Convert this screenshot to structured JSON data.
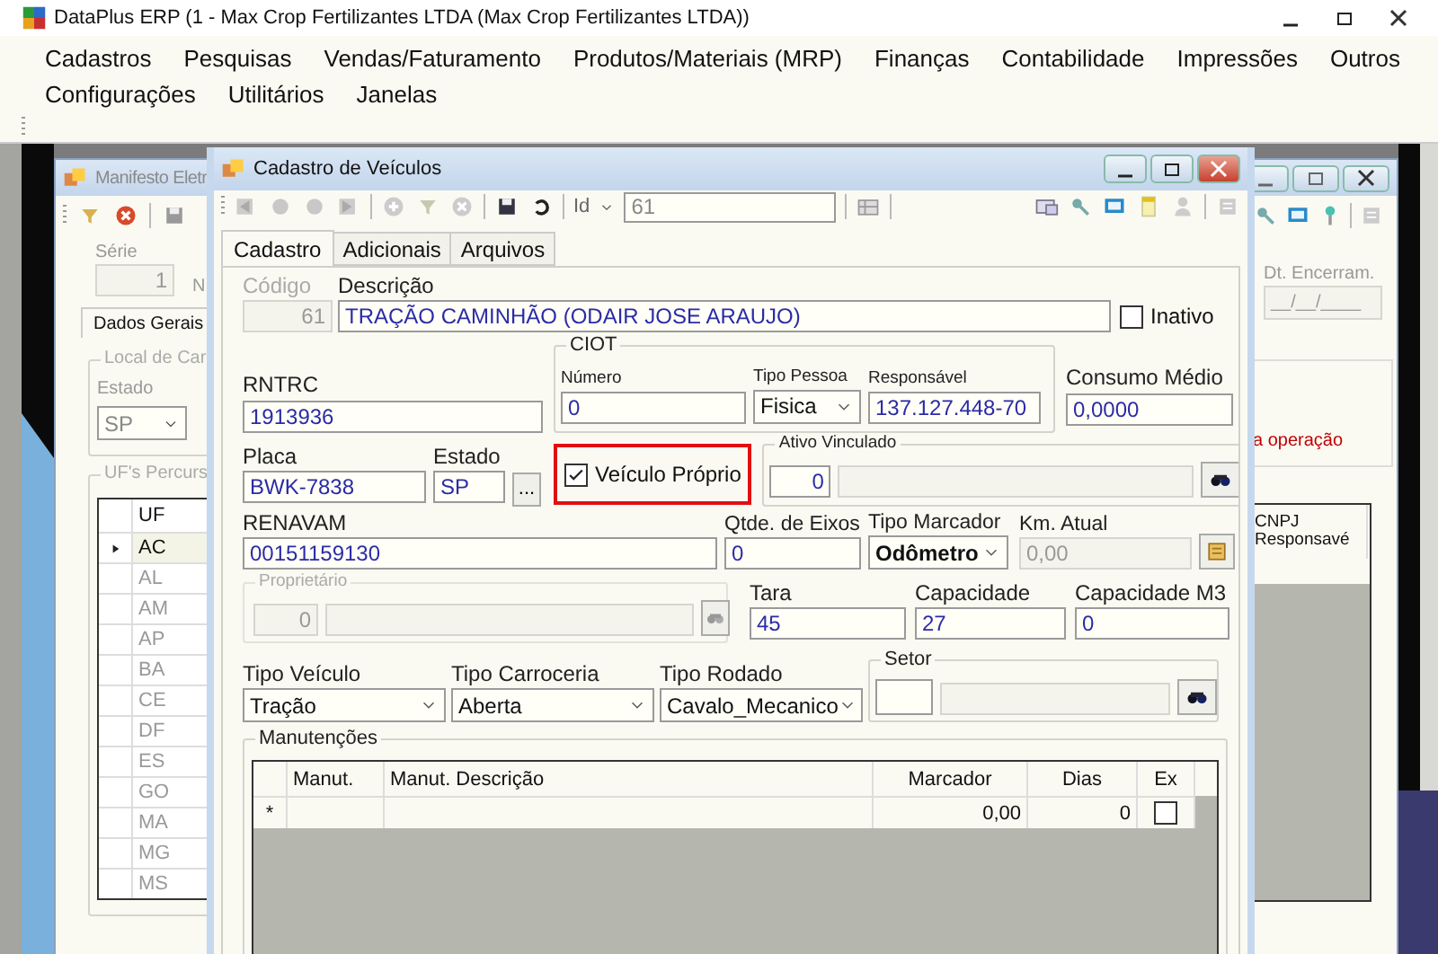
{
  "app": {
    "title": "DataPlus ERP (1 - Max Crop Fertilizantes LTDA  (Max Crop Fertilizantes LTDA))",
    "menu_rows": [
      {
        "items": [
          "Cadastros",
          "Pesquisas",
          "Vendas/Faturamento",
          "Produtos/Materiais (MRP)",
          "Finanças",
          "Contabilidade",
          "Impressões",
          "Outros"
        ]
      },
      {
        "items": [
          "Configurações",
          "Utilitários",
          "Janelas"
        ]
      }
    ]
  },
  "background_window": {
    "title": "Manifesto Eletr",
    "serie_label": "Série",
    "serie_value": "1",
    "numero_label": "N",
    "tabs": [
      {
        "label": "Dados Gerais",
        "selected": true
      }
    ],
    "local_group": "Local de Car",
    "estado_label": "Estado",
    "estado_value": "SP",
    "uf_group": "UF's Percurs",
    "uf_column": "UF",
    "uf_rows": [
      {
        "uf": "AC",
        "selected": true
      },
      {
        "uf": "AL",
        "selected": false
      },
      {
        "uf": "AM",
        "selected": false
      },
      {
        "uf": "AP",
        "selected": false
      },
      {
        "uf": "BA",
        "selected": false
      },
      {
        "uf": "CE",
        "selected": false
      },
      {
        "uf": "DF",
        "selected": false
      },
      {
        "uf": "ES",
        "selected": false
      },
      {
        "uf": "GO",
        "selected": false
      },
      {
        "uf": "MA",
        "selected": false
      },
      {
        "uf": "MG",
        "selected": false
      },
      {
        "uf": "MS",
        "selected": false
      }
    ],
    "dt_label": "Dt. Encerram.",
    "dt_value": "__/__/____",
    "warning": "a operação",
    "cnpj_column": "CNPJ Responsavé"
  },
  "dialog": {
    "title": "Cadastro de Veículos",
    "id_label": "Id",
    "id_value": "61",
    "tabs": [
      {
        "label": "Cadastro",
        "selected": true
      },
      {
        "label": "Adicionais",
        "selected": false
      },
      {
        "label": "Arquivos",
        "selected": false
      }
    ],
    "codigo": {
      "label": "Código",
      "value": "61",
      "disabled": true
    },
    "descricao": {
      "label": "Descrição",
      "value": "TRAÇÃO CAMINHÃO (ODAIR JOSE ARAUJO)"
    },
    "inativo": {
      "label": "Inativo",
      "checked": false
    },
    "rntrc": {
      "label": "RNTRC",
      "value": "1913936"
    },
    "ciot": {
      "title": "CIOT",
      "numero_label": "Número",
      "numero_value": "0",
      "tipo_pessoa_label": "Tipo Pessoa",
      "tipo_pessoa_value": "Fisica",
      "responsavel_label": "Responsável",
      "responsavel_value": "137.127.448-70"
    },
    "consumo": {
      "label": "Consumo Médio",
      "value": "0,0000"
    },
    "placa": {
      "label": "Placa",
      "value": "BWK-7838"
    },
    "estado": {
      "label": "Estado",
      "value": "SP",
      "button": "..."
    },
    "veiculo_proprio": {
      "label": "Veículo Próprio",
      "checked": true,
      "highlighted": true
    },
    "ativo_vinculado": {
      "title": "Ativo Vinculado",
      "value": "0"
    },
    "renavam": {
      "label": "RENAVAM",
      "value": "00151159130"
    },
    "eixos": {
      "label": "Qtde. de Eixos",
      "value": "0"
    },
    "tipo_marcador": {
      "label": "Tipo Marcador",
      "value": "Odômetro"
    },
    "km_atual": {
      "label": "Km. Atual",
      "value": "0,00",
      "disabled": true
    },
    "proprietario": {
      "title": "Proprietário",
      "value": "0",
      "disabled": true
    },
    "tara": {
      "label": "Tara",
      "value": "45"
    },
    "capacidade": {
      "label": "Capacidade",
      "value": "27"
    },
    "capacidade_m3": {
      "label": "Capacidade M3",
      "value": "0"
    },
    "tipo_veiculo": {
      "label": "Tipo Veículo",
      "value": "Tração"
    },
    "tipo_carroceria": {
      "label": "Tipo Carroceria",
      "value": "Aberta"
    },
    "tipo_rodado": {
      "label": "Tipo Rodado",
      "value": "Cavalo_Mecanico"
    },
    "setor": {
      "title": "Setor"
    },
    "manutencoes": {
      "title": "Manutenções",
      "columns": [
        "Manut.",
        "Manut. Descrição",
        "Marcador",
        "Dias",
        "Ex"
      ],
      "rows": [
        {
          "marker": "*",
          "marcador": "0,00",
          "dias": "0",
          "ex": false
        }
      ]
    }
  }
}
